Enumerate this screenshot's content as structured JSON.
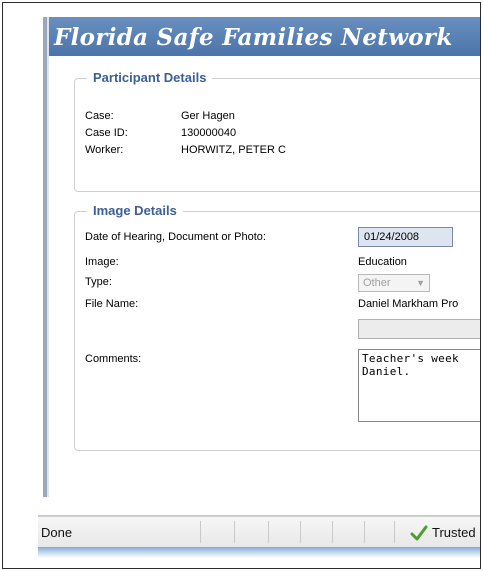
{
  "banner": {
    "title": "Florida Safe Families Network"
  },
  "participant": {
    "legend": "Participant Details",
    "case_label": "Case:",
    "case_value": "Ger Hagen",
    "case_id_label": "Case ID:",
    "case_id_value": "130000040",
    "worker_label": "Worker:",
    "worker_value": "HORWITZ, PETER C"
  },
  "image_details": {
    "legend": "Image Details",
    "date_label": "Date of Hearing, Document or Photo:",
    "date_value": "01/24/2008",
    "image_label": "Image:",
    "image_value": "Education",
    "type_label": "Type:",
    "type_value": "Other",
    "file_name_label": "File Name:",
    "file_name_value": "Daniel Markham Pro",
    "comments_label": "Comments:",
    "comments_value": "Teacher's week\nDaniel."
  },
  "status_bar": {
    "status": "Done",
    "security_label": "Trusted",
    "check_color": "#4aa02c"
  }
}
